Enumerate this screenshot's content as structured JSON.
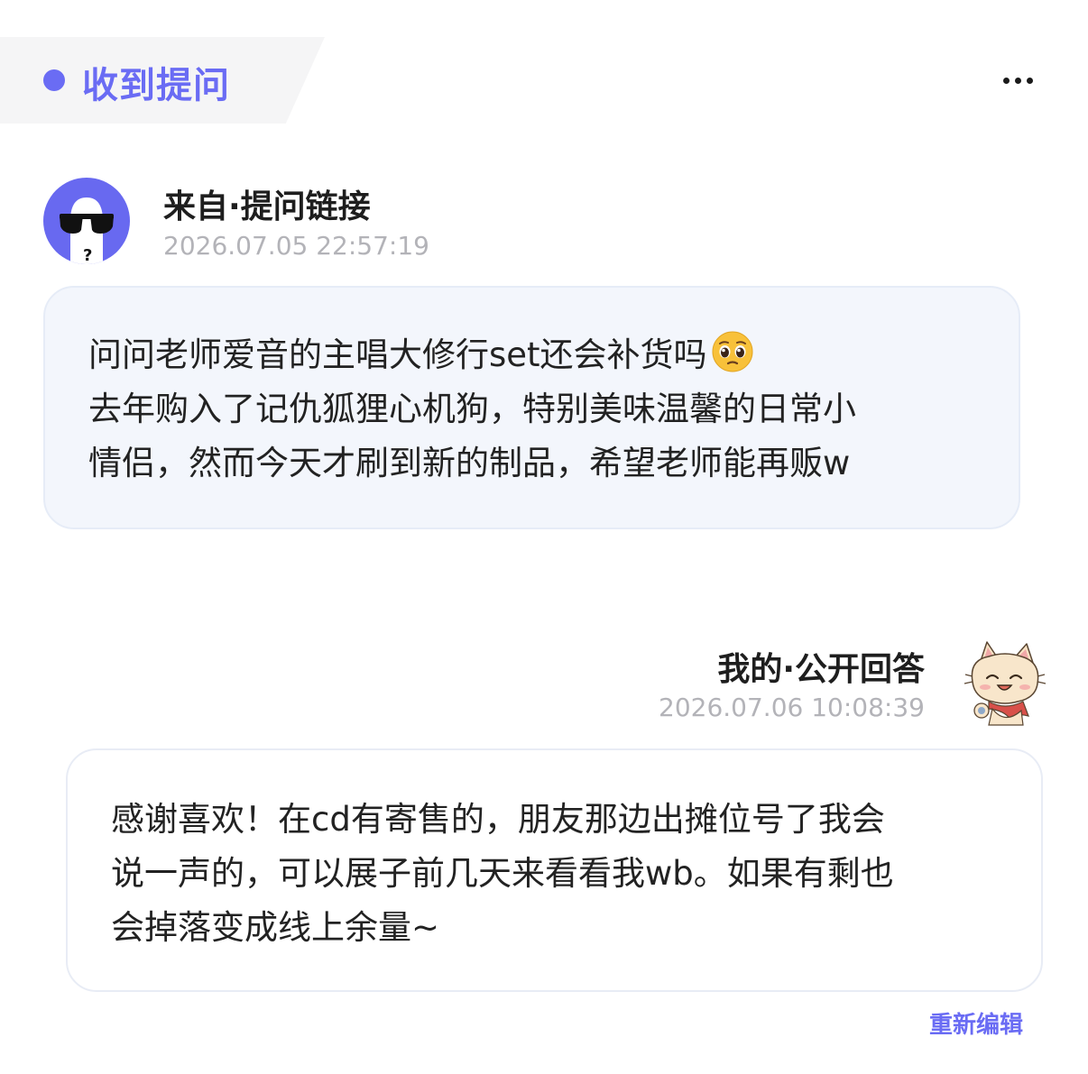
{
  "header": {
    "title": "收到提问",
    "accent_color": "#6a6cf4",
    "more_icon": "more-horizontal-icon"
  },
  "question": {
    "sender": "来自·提问链接",
    "time": "2026.07.05 22:57:19",
    "avatar_icon": "anonymous-sunglasses-avatar",
    "line1": "问问老师爱音的主唱大修行set还会补货吗",
    "emoji": "pleading-face-emoji",
    "line2": "去年购入了记仇狐狸心机狗，特别美味温馨的日常小",
    "line3": "情侣，然而今天才刷到新的制品，希望老师能再贩w"
  },
  "answer": {
    "author": "我的·公开回答",
    "time": "2026.07.06 10:08:39",
    "avatar_icon": "cat-character-avatar",
    "line1": "感谢喜欢！在cd有寄售的，朋友那边出摊位号了我会",
    "line2": "说一声的，可以展子前几天来看看我wb。如果有剩也",
    "line3": "会掉落变成线上余量~",
    "reedit_label": "重新编辑"
  }
}
